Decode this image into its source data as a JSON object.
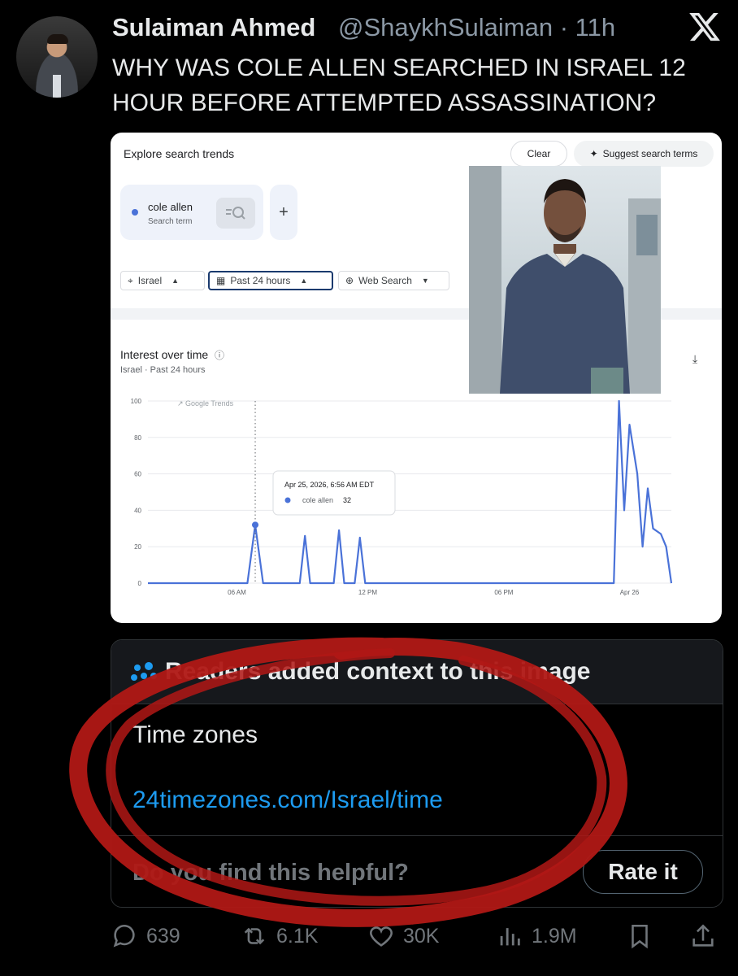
{
  "tweet": {
    "author_name": "Sulaiman Ahmed",
    "handle_time": "@ShaykhSulaiman · 11h",
    "text": "WHY WAS COLE ALLEN SEARCHED IN ISRAEL 12 HOUR BEFORE ATTEMPTED ASSASSINATION?"
  },
  "trends_image": {
    "header_title": "Explore search trends",
    "clear_label": "Clear",
    "suggest_label": "Suggest search terms",
    "term": {
      "name": "cole allen",
      "type": "Search term"
    },
    "add_label": "+",
    "filters": {
      "region": "Israel",
      "period": "Past 24 hours",
      "source": "Web Search"
    },
    "interest_title": "Interest over time",
    "interest_sub": "Israel · Past 24 hours",
    "watermark": "Google Trends",
    "tooltip": {
      "date": "Apr 25, 2026, 6:56 AM EDT",
      "term": "cole allen",
      "value": "32"
    }
  },
  "chart_data": {
    "type": "line",
    "title": "Interest over time",
    "ylim": [
      0,
      100
    ],
    "yticks": [
      "100",
      "80",
      "60",
      "40",
      "20",
      "0"
    ],
    "xticks": [
      "06 AM",
      "12 PM",
      "06 PM",
      "Apr 26"
    ],
    "series": [
      {
        "name": "cole allen",
        "color": "#4a72d8",
        "points": [
          [
            0,
            0
          ],
          [
            0.19,
            0
          ],
          [
            0.205,
            32
          ],
          [
            0.22,
            0
          ],
          [
            0.29,
            0
          ],
          [
            0.3,
            26
          ],
          [
            0.31,
            0
          ],
          [
            0.355,
            0
          ],
          [
            0.365,
            29
          ],
          [
            0.375,
            0
          ],
          [
            0.395,
            0
          ],
          [
            0.405,
            25
          ],
          [
            0.415,
            0
          ],
          [
            0.89,
            0
          ],
          [
            0.9,
            100
          ],
          [
            0.91,
            40
          ],
          [
            0.92,
            87
          ],
          [
            0.935,
            60
          ],
          [
            0.945,
            20
          ],
          [
            0.955,
            52
          ],
          [
            0.965,
            30
          ],
          [
            0.98,
            27
          ],
          [
            0.99,
            20
          ],
          [
            1.0,
            0
          ]
        ]
      }
    ]
  },
  "community_note": {
    "header": "Readers added context to this image",
    "body": "Time zones",
    "link": "24timezones.com/Israel/time",
    "question": "Do you find this helpful?",
    "rate_label": "Rate it"
  },
  "actions": {
    "replies": "639",
    "reposts": "6.1K",
    "likes": "30K",
    "views": "1.9M"
  },
  "colors": {
    "background": "#000000",
    "link": "#1d9bf0",
    "secondary_text": "#71767b",
    "annotation_red": "#b01815",
    "trend_line": "#4a72d8"
  }
}
